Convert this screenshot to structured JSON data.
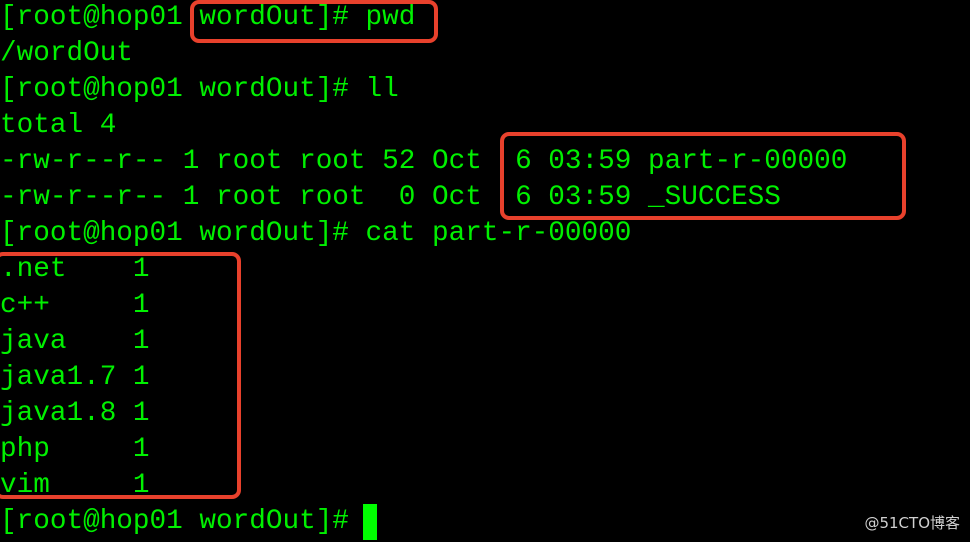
{
  "terminal": {
    "lines": [
      "[root@hop01 wordOut]# pwd",
      "/wordOut",
      "[root@hop01 wordOut]# ll",
      "total 4",
      "-rw-r--r-- 1 root root 52 Oct  6 03:59 part-r-00000",
      "-rw-r--r-- 1 root root  0 Oct  6 03:59 _SUCCESS",
      "[root@hop01 wordOut]# cat part-r-00000",
      ".net    1",
      "c++     1",
      "java    1",
      "java1.7 1",
      "java1.8 1",
      "php     1",
      "vim     1",
      "[root@hop01 wordOut]# "
    ],
    "text_color": "#00f000",
    "background": "#000000",
    "highlight_color": "#e8412c"
  },
  "watermark": "@51CTO博客"
}
